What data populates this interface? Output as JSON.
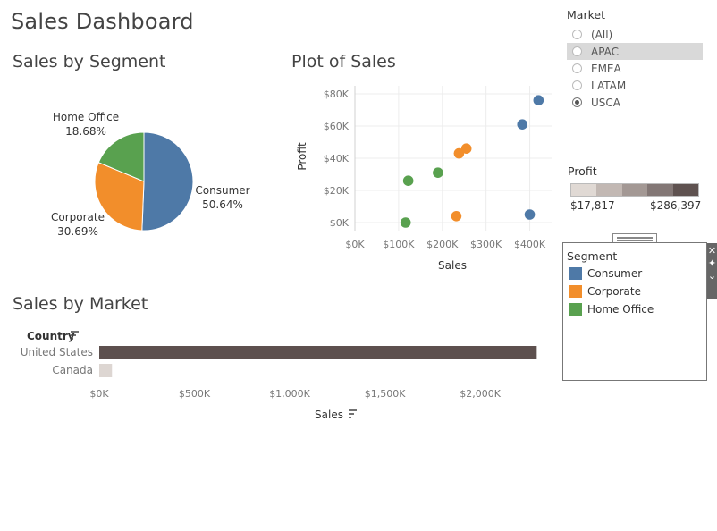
{
  "dashboard": {
    "title": "Sales Dashboard"
  },
  "segment_chart": {
    "title": "Sales by Segment",
    "labels": [
      {
        "name": "Consumer",
        "pct": "50.64%"
      },
      {
        "name": "Corporate",
        "pct": "30.69%"
      },
      {
        "name": "Home Office",
        "pct": "18.68%"
      }
    ]
  },
  "scatter_chart": {
    "title": "Plot of Sales"
  },
  "market_chart": {
    "title": "Sales by Market",
    "row_header": "Country",
    "x_title": "Sales"
  },
  "market_filter": {
    "title": "Market",
    "options": [
      "(All)",
      "APAC",
      "EMEA",
      "LATAM",
      "USCA"
    ],
    "selected": "USCA",
    "hovered": "APAC"
  },
  "profit_legend": {
    "title": "Profit",
    "min_label": "$17,817",
    "max_label": "$286,397",
    "colors": [
      "#e0d9d4",
      "#c2b8b3",
      "#a39894",
      "#837775",
      "#5f5250"
    ]
  },
  "segment_legend": {
    "title": "Segment",
    "items": [
      {
        "label": "Consumer",
        "color": "#4e79a7"
      },
      {
        "label": "Corporate",
        "color": "#f28e2b"
      },
      {
        "label": "Home Office",
        "color": "#59a14f"
      }
    ]
  },
  "colors": {
    "consumer": "#4e79a7",
    "corporate": "#f28e2b",
    "home_office": "#59a14f",
    "bar_dark": "#5d504e",
    "bar_light": "#ddd6d2"
  },
  "chart_data": [
    {
      "type": "pie",
      "title": "Sales by Segment",
      "categories": [
        "Consumer",
        "Corporate",
        "Home Office"
      ],
      "values": [
        50.64,
        30.69,
        18.68
      ],
      "unit": "%"
    },
    {
      "type": "scatter",
      "title": "Plot of Sales",
      "xlabel": "Sales",
      "ylabel": "Profit",
      "xlim": [
        0,
        450000
      ],
      "ylim": [
        -5000,
        85000
      ],
      "x_ticks": [
        "$0K",
        "$100K",
        "$200K",
        "$300K",
        "$400K"
      ],
      "x_tick_values": [
        0,
        100000,
        200000,
        300000,
        400000
      ],
      "y_ticks": [
        "$0K",
        "$20K",
        "$40K",
        "$60K",
        "$80K"
      ],
      "y_tick_values": [
        0,
        20000,
        40000,
        60000,
        80000
      ],
      "series": [
        {
          "name": "Consumer",
          "points": [
            [
              420000,
              76000
            ],
            [
              383000,
              61000
            ],
            [
              400000,
              5000
            ]
          ]
        },
        {
          "name": "Corporate",
          "points": [
            [
              238000,
              43000
            ],
            [
              255000,
              46000
            ],
            [
              232000,
              4000
            ]
          ]
        },
        {
          "name": "Home Office",
          "points": [
            [
              122000,
              26000
            ],
            [
              190000,
              31000
            ],
            [
              116000,
              0
            ]
          ]
        }
      ]
    },
    {
      "type": "bar",
      "title": "Sales by Market",
      "orientation": "horizontal",
      "categories": [
        "United States",
        "Canada"
      ],
      "values": [
        2297000,
        66900
      ],
      "xlabel": "Sales",
      "ylabel": "Country",
      "xlim": [
        0,
        2300000
      ],
      "x_ticks": [
        "$0K",
        "$500K",
        "$1,000K",
        "$1,500K",
        "$2,000K"
      ],
      "x_tick_values": [
        0,
        500000,
        1000000,
        1500000,
        2000000
      ]
    }
  ]
}
